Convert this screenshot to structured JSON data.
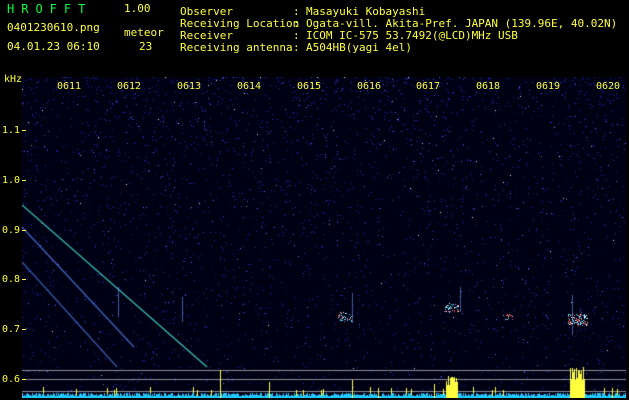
{
  "app": {
    "title": "HROFFT",
    "version": "1.00",
    "filename": "0401230610.png",
    "datetime": "04.01.23 06:10"
  },
  "meteor": {
    "label": "meteor",
    "count": "23"
  },
  "meta": [
    {
      "key": "Observer",
      "sep": ":",
      "value": "Masayuki Kobayashi"
    },
    {
      "key": "Receiving Location",
      "sep": ":",
      "value": "Ogata-vill. Akita-Pref. JAPAN (139.96E, 40.02N)"
    },
    {
      "key": "Receiver",
      "sep": ":",
      "value": "ICOM IC-575 53.7492(@LCD)MHz USB"
    },
    {
      "key": "Receiving antenna",
      "sep": ":",
      "value": "A504HB(yagi 4el)"
    }
  ],
  "axis": {
    "y_unit": "kHz",
    "y_ticks": [
      "1.1",
      "1.0",
      "0.9",
      "0.8",
      "0.7",
      "0.6"
    ],
    "x_ticks": [
      "0611",
      "0612",
      "0613",
      "0614",
      "0615",
      "0616",
      "0617",
      "0618",
      "0619",
      "0620"
    ]
  },
  "colors": {
    "text": "#ffff40",
    "title": "#00ff40",
    "background": "#000000",
    "noise": "#1f3fbf",
    "trail": "#40e0d0"
  }
}
